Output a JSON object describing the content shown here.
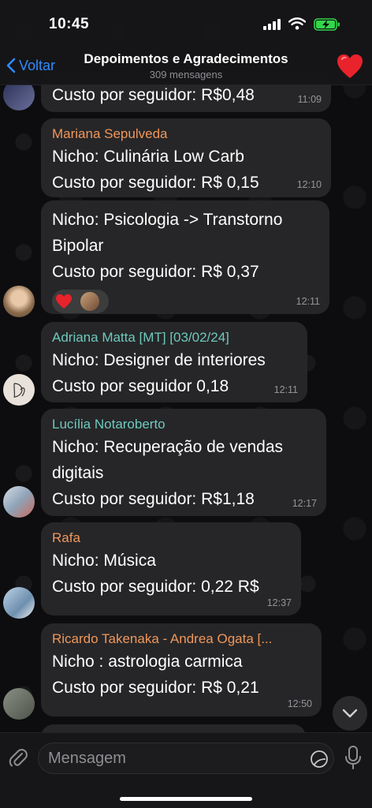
{
  "status_bar": {
    "time": "10:45"
  },
  "header": {
    "back_label": "Voltar",
    "title": "Depoimentos e Agradecimentos",
    "subtitle": "309 mensagens"
  },
  "messages": [
    {
      "sender": "",
      "lines": [
        "Custo por seguidor: R$0,48"
      ],
      "time": "11:09"
    },
    {
      "sender": "Mariana Sepulveda",
      "sender_color": "#f0975a",
      "lines": [
        "Nicho: Culinária Low Carb",
        "Custo por seguidor: R$ 0,15"
      ],
      "time": "12:10"
    },
    {
      "sender": "",
      "lines": [
        "Nicho: Psicologia -> Transtorno",
        "Bipolar",
        "Custo por seguidor: R$ 0,37"
      ],
      "time": "12:11",
      "reaction": "heart"
    },
    {
      "sender": "Adriana Matta [MT] [03/02/24]",
      "sender_color": "#6ec9bd",
      "lines": [
        "Nicho: Designer de interiores",
        "Custo por seguidor 0,18"
      ],
      "time": "12:11"
    },
    {
      "sender": "Lucília Notaroberto",
      "sender_color": "#6ec9bd",
      "lines": [
        "Nicho: Recuperação de vendas",
        "digitais",
        "Custo por seguidor: R$1,18"
      ],
      "time": "12:17"
    },
    {
      "sender": "Rafa",
      "sender_color": "#f0975a",
      "lines": [
        "Nicho: Música",
        "Custo por seguidor: 0,22 R$"
      ],
      "time": "12:37"
    },
    {
      "sender": "Ricardo Takenaka - Andrea Ogata [...",
      "sender_color": "#f0975a",
      "lines": [
        "Nicho : astrologia carmica",
        "Custo por seguidor: R$ 0,21"
      ],
      "time": "12:50"
    }
  ],
  "input": {
    "placeholder": "Mensagem"
  },
  "colors": {
    "accent": "#2f8bff",
    "bubble": "#262628",
    "heart": "#e8232c"
  }
}
